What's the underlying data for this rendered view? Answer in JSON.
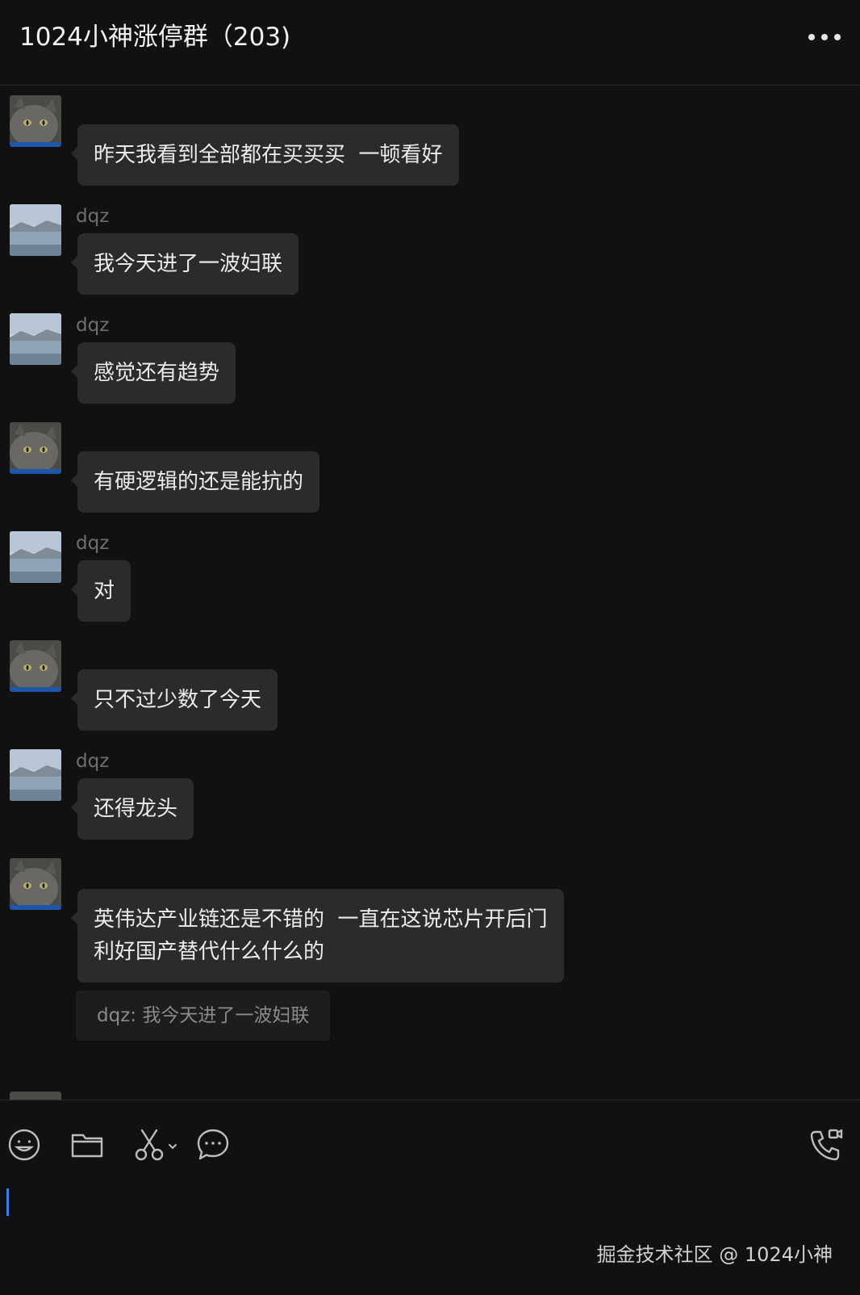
{
  "header": {
    "title": "1024小神涨停群（203)",
    "more_icon": "more-horizontal-icon"
  },
  "messages": [
    {
      "sender": "",
      "avatar": "cat-avatar",
      "text": "昨天我看到全部都在买买买  一顿看好"
    },
    {
      "sender": "dqz",
      "avatar": "sea-avatar",
      "text": "我今天进了一波妇联"
    },
    {
      "sender": "dqz",
      "avatar": "sea-avatar",
      "text": "感觉还有趋势"
    },
    {
      "sender": "",
      "avatar": "cat-avatar",
      "text": "有硬逻辑的还是能抗的"
    },
    {
      "sender": "dqz",
      "avatar": "sea-avatar",
      "text": "对"
    },
    {
      "sender": "",
      "avatar": "cat-avatar",
      "text": "只不过少数了今天"
    },
    {
      "sender": "dqz",
      "avatar": "sea-avatar",
      "text": "还得龙头"
    },
    {
      "sender": "",
      "avatar": "cat-avatar",
      "text": "英伟达产业链还是不错的  一直在这说芯片开后门\n利好国产替代什么什么的",
      "quote": "dqz: 我今天进了一波妇联"
    }
  ],
  "toolbar": {
    "icons": [
      "emoji-icon",
      "folder-icon",
      "scissors-icon",
      "chat-bubble-icon",
      "phone-video-icon"
    ]
  },
  "watermark": "掘金技术社区 @ 1024小神",
  "colors": {
    "background": "#111111",
    "bubble": "#2b2b2b",
    "caret": "#3d7bf0"
  }
}
